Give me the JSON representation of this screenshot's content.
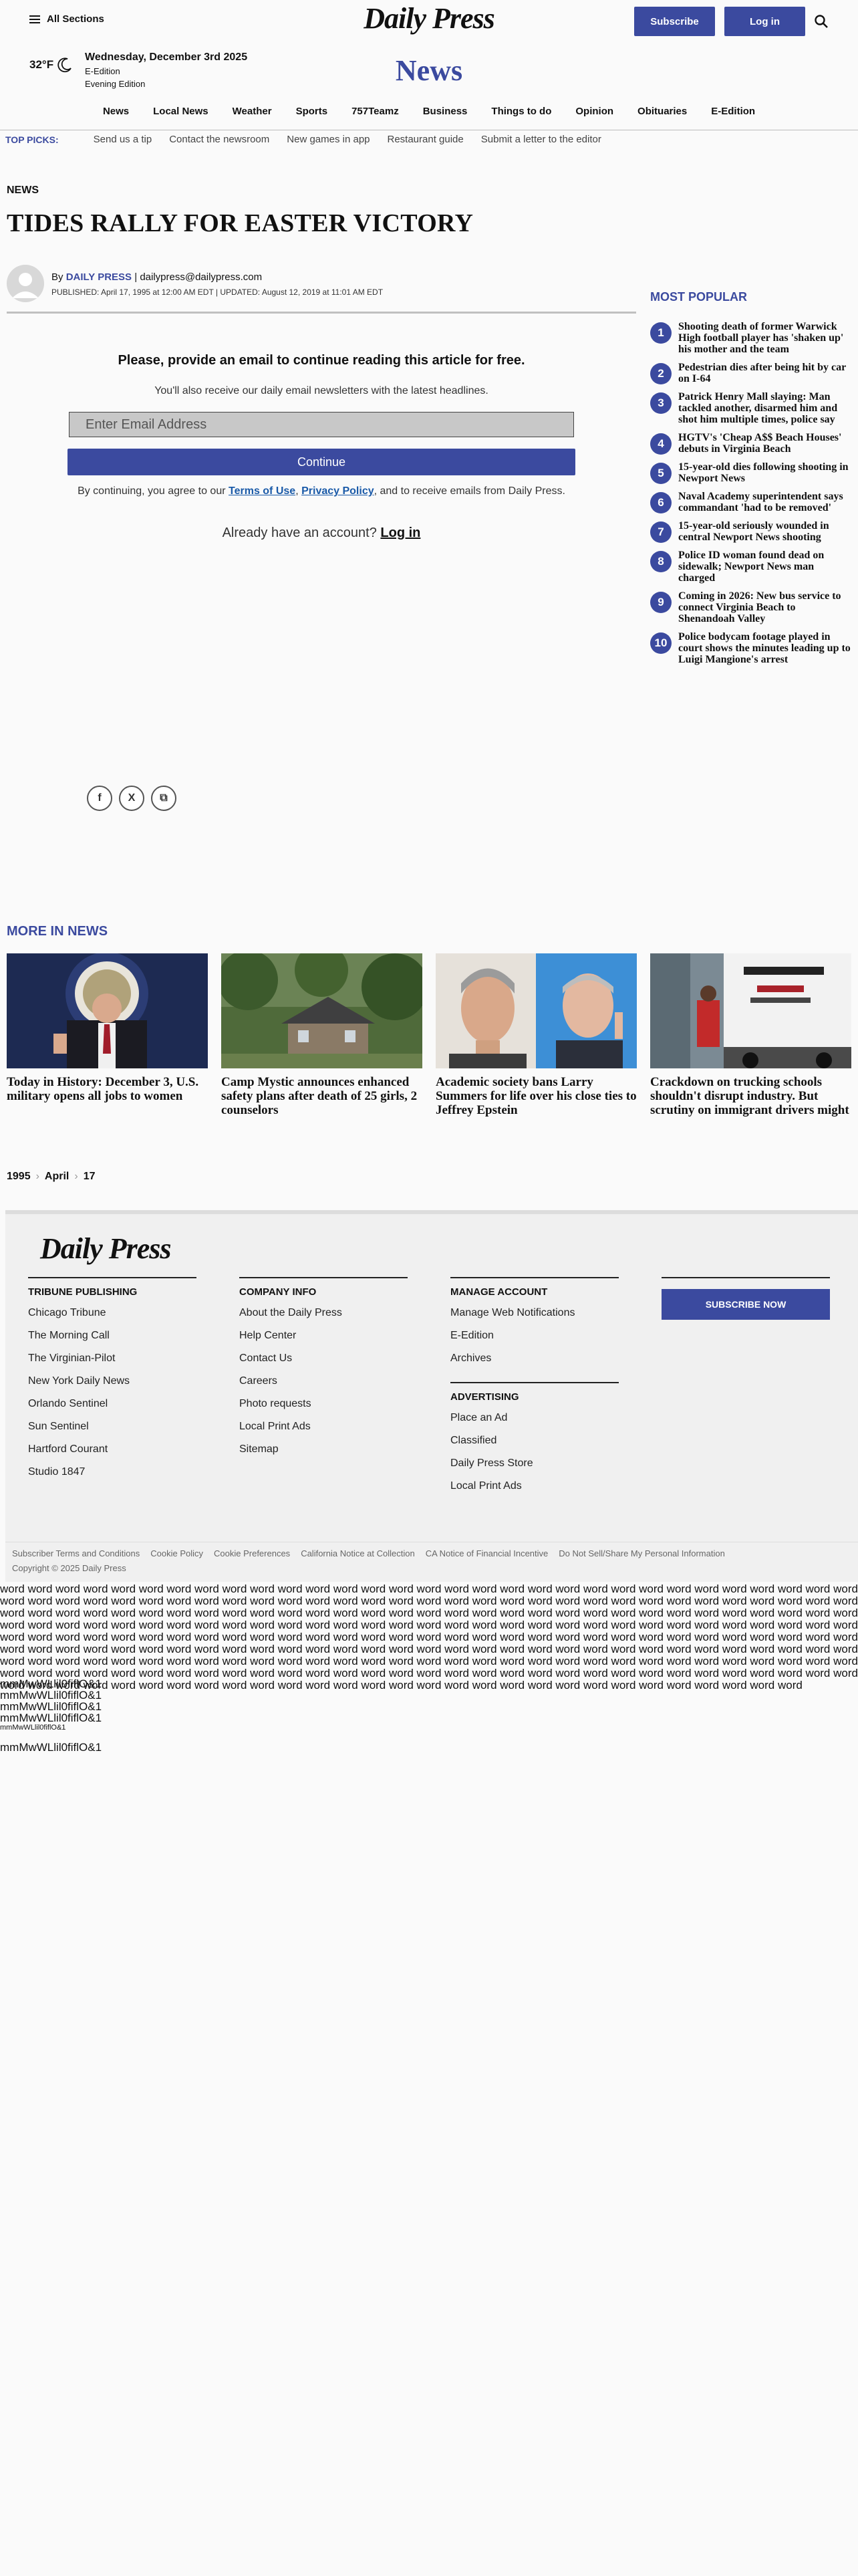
{
  "header": {
    "sections_label": "All Sections",
    "logo": "Daily Press",
    "subscribe": "Subscribe",
    "login": "Log in",
    "weather": "32°F",
    "date": "Wednesday, December 3rd 2025",
    "edition1": "E-Edition",
    "edition2": "Evening Edition",
    "section": "News"
  },
  "nav": [
    "News",
    "Local News",
    "Weather",
    "Sports",
    "757Teamz",
    "Business",
    "Things to do",
    "Opinion",
    "Obituaries",
    "E-Edition"
  ],
  "top_picks": {
    "label": "TOP PICKS:",
    "items": [
      "Send us a tip",
      "Contact the newsroom",
      "New games in app",
      "Restaurant guide",
      "Submit a letter to the editor"
    ]
  },
  "article": {
    "kicker": "NEWS",
    "headline": "TIDES RALLY FOR EASTER VICTORY",
    "by": "By",
    "author": "DAILY PRESS",
    "sep": "|",
    "email": "dailypress@dailypress.com",
    "published": "PUBLISHED: April 17, 1995 at 12:00 AM EDT | UPDATED: August 12, 2019 at 11:01 AM EDT"
  },
  "gate": {
    "title": "Please, provide an email to continue reading this article for free.",
    "subtitle": "You'll also receive our daily email newsletters with the latest headlines.",
    "placeholder": "Enter Email Address",
    "continue": "Continue",
    "terms_pre": "By continuing, you agree to our",
    "terms_link": "Terms of Use",
    "terms_comma": ",",
    "privacy_link": "Privacy Policy",
    "terms_post": ", and to receive emails from Daily Press.",
    "already": "Already have an account?",
    "login_link": "Log in"
  },
  "share": {
    "facebook": "f",
    "x": "X",
    "copy": "⧉"
  },
  "most_popular": {
    "title": "MOST POPULAR",
    "items": [
      {
        "n": "1",
        "t": "Shooting death of former Warwick High football player has 'shaken up' his mother and the team"
      },
      {
        "n": "2",
        "t": "Pedestrian dies after being hit by car on I-64"
      },
      {
        "n": "3",
        "t": "Patrick Henry Mall slaying: Man tackled another, disarmed him and shot him multiple times, police say"
      },
      {
        "n": "4",
        "t": "HGTV's 'Cheap A$$ Beach Houses' debuts in Virginia Beach"
      },
      {
        "n": "5",
        "t": "15-year-old dies following shooting in Newport News"
      },
      {
        "n": "6",
        "t": "Naval Academy superintendent says commandant 'had to be removed'"
      },
      {
        "n": "7",
        "t": "15-year-old seriously wounded in central Newport News shooting"
      },
      {
        "n": "8",
        "t": "Police ID woman found dead on sidewalk; Newport News man charged"
      },
      {
        "n": "9",
        "t": "Coming in 2026: New bus service to connect Virginia Beach to Shenandoah Valley"
      },
      {
        "n": "10",
        "t": "Police bodycam footage played in court shows the minutes leading up to Luigi Mangione's arrest"
      }
    ]
  },
  "more_in_news": {
    "title": "MORE IN NEWS",
    "cards": [
      {
        "caption": "Today in History: December 3, U.S. military opens all jobs to women"
      },
      {
        "caption": "Camp Mystic announces enhanced safety plans after death of 25 girls, 2 counselors"
      },
      {
        "caption": "Academic society bans Larry Summers for life over his close ties to Jeffrey Epstein"
      },
      {
        "caption": "Crackdown on trucking schools shouldn't disrupt industry. But scrutiny on immigrant drivers might"
      }
    ]
  },
  "breadcrumb": [
    "1995",
    "April",
    "17"
  ],
  "footer": {
    "logo": "Daily Press",
    "tribune": {
      "title": "TRIBUNE PUBLISHING",
      "links": [
        "Chicago Tribune",
        "The Morning Call",
        "The Virginian-Pilot",
        "New York Daily News",
        "Orlando Sentinel",
        "Sun Sentinel",
        "Hartford Courant",
        "Studio 1847"
      ]
    },
    "company": {
      "title": "COMPANY INFO",
      "links": [
        "About the Daily Press",
        "Help Center",
        "Contact Us",
        "Careers",
        "Photo requests",
        "Local Print Ads",
        "Sitemap"
      ]
    },
    "manage": {
      "title": "MANAGE ACCOUNT",
      "links": [
        "Manage Web Notifications",
        "E-Edition",
        "Archives"
      ]
    },
    "advertising": {
      "title": "ADVERTISING",
      "links": [
        "Place an Ad",
        "Classified",
        "Daily Press Store",
        "Local Print Ads"
      ]
    },
    "subscribe": "SUBSCRIBE NOW",
    "legal": [
      "Subscriber Terms and Conditions",
      "Cookie Policy",
      "Cookie Preferences",
      "California Notice at Collection",
      "CA Notice of Financial Incentive",
      "Do Not Sell/Share My Personal Information"
    ],
    "copyright": "Copyright © 2025 Daily Press"
  },
  "filler": {
    "words": "word word word word word word word word word word word word word word word word word word word word word word word word word word word word word word word word word word word word word word word word word word word word word word word word word word word word word word word word word word word word word word word word word word word word word word word word word word word word word word word word word word word word word word word word word word word word word word word word word word word word word word word word word word word word word word word word word word word word word word word word word word word word word word word word word word word word word word word word word word word word word word word word word word word word word word word word word word word word word word word word word word word word word word word word word word word word word word word word word word word word word word word word word word word word word word word word word word word word word word word word word word word word word word word word word word word word word word word word word word word word word word word word word word word word word word word word word word word word word word word word word word word word word word word word word word word word word word word word word word word word word word word word word word word word word word word word word word word word word",
    "tests": [
      "mmMwWLlil0fiflO&1",
      "mmMwWLlil0fiflO&1",
      "mmMwWLlil0fiflO&1",
      "mmMwWLlil0fiflO&1",
      "mmMwWLlil0fiflO&1",
      "mmMwWLlil0fiflO&1"
    ]
  }
}
